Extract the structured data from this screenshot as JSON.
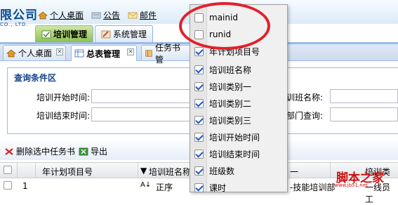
{
  "header": {
    "brand": "限公司",
    "brand_sub": "CO., LTD.",
    "links": [
      {
        "label": "个人桌面",
        "icon": "home-icon"
      },
      {
        "label": "公告",
        "icon": "announcement-icon"
      },
      {
        "label": "邮件",
        "icon": "mail-icon"
      }
    ]
  },
  "module_tabs": [
    {
      "label": "培训管理",
      "active": true,
      "icon": "training-module-icon"
    },
    {
      "label": "系统管理",
      "active": false,
      "icon": "system-module-icon"
    }
  ],
  "page_tabs": [
    {
      "label": "个人桌面",
      "active": false,
      "icon": "home-icon"
    },
    {
      "label": "总表管理",
      "active": true,
      "icon": "table-icon"
    },
    {
      "label": "任务书管",
      "active": false,
      "icon": "book-icon"
    }
  ],
  "query": {
    "title": "查询条件区",
    "fields": [
      {
        "label": "培训开始时间:"
      },
      {
        "label": "培训结束时间:"
      },
      {
        "label": "训班名称:"
      },
      {
        "label": "部门查询:"
      }
    ]
  },
  "toolbar": {
    "delete_label": "删除选中任务书",
    "export_label": "导出"
  },
  "grid": {
    "headers": [
      "年计划项目号",
      "培训班名称",
      "一",
      "培训类别"
    ],
    "row1": {
      "num": "1",
      "sort_label": "正序",
      "dept": "技能培训部",
      "last": "一线员工"
    }
  },
  "column_menu": [
    {
      "label": "mainid",
      "checked": false
    },
    {
      "label": "runid",
      "checked": false
    },
    {
      "label": "年计划项目号",
      "checked": true
    },
    {
      "label": "培训班名称",
      "checked": true
    },
    {
      "label": "培训类别一",
      "checked": true
    },
    {
      "label": "培训类别二",
      "checked": true
    },
    {
      "label": "培训类别三",
      "checked": true
    },
    {
      "label": "培训开始时间",
      "checked": true
    },
    {
      "label": "培训结束时间",
      "checked": true
    },
    {
      "label": "班级数",
      "checked": true
    },
    {
      "label": "课时",
      "checked": true
    }
  ],
  "watermark": {
    "title": "脚本之家",
    "url": "www.jb51.net"
  },
  "colors": {
    "highlight_oval": "#e2202a",
    "tab_active_green": "#8fc050",
    "panel_border": "#99bbe8",
    "title_blue": "#15428b"
  }
}
